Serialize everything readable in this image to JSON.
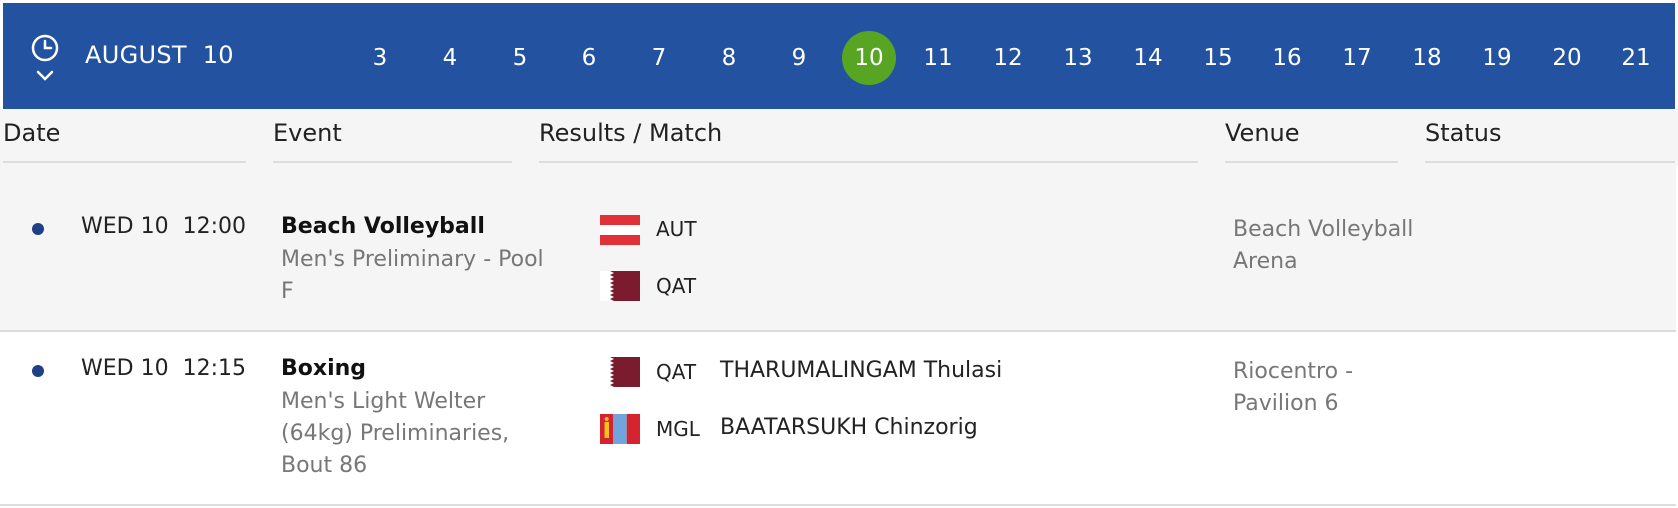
{
  "colors": {
    "header_bg": "#2352a0",
    "active_day": "#58a524",
    "row_alt_bg": "#f5f5f5",
    "dot": "#1f3f86"
  },
  "topbar": {
    "clock_icon": "clock-icon",
    "chevron_icon": "chevron-down-icon",
    "month": "AUGUST",
    "selected_day": "10",
    "days": [
      "3",
      "4",
      "5",
      "6",
      "7",
      "8",
      "9",
      "10",
      "11",
      "12",
      "13",
      "14",
      "15",
      "16",
      "17",
      "18",
      "19",
      "20",
      "21"
    ]
  },
  "columns": {
    "date": "Date",
    "event": "Event",
    "results": "Results / Match",
    "venue": "Venue",
    "status": "Status"
  },
  "rows": [
    {
      "date": "WED 10",
      "time": "12:00",
      "sport": "Beach Volleyball",
      "detail": "Men's Preliminary - Pool F",
      "competitors": [
        {
          "flag": "austria-flag",
          "code": "AUT",
          "name": ""
        },
        {
          "flag": "qatar-flag",
          "code": "QAT",
          "name": ""
        }
      ],
      "venue": "Beach Volleyball Arena",
      "status": ""
    },
    {
      "date": "WED 10",
      "time": "12:15",
      "sport": "Boxing",
      "detail": "Men's Light Welter (64kg) Preliminaries, Bout 86",
      "competitors": [
        {
          "flag": "qatar-flag",
          "code": "QAT",
          "name": "THARUMALINGAM Thulasi"
        },
        {
          "flag": "mongolia-flag",
          "code": "MGL",
          "name": "BAATARSUKH Chinzorig"
        }
      ],
      "venue": "Riocentro - Pavilion 6",
      "status": ""
    }
  ]
}
